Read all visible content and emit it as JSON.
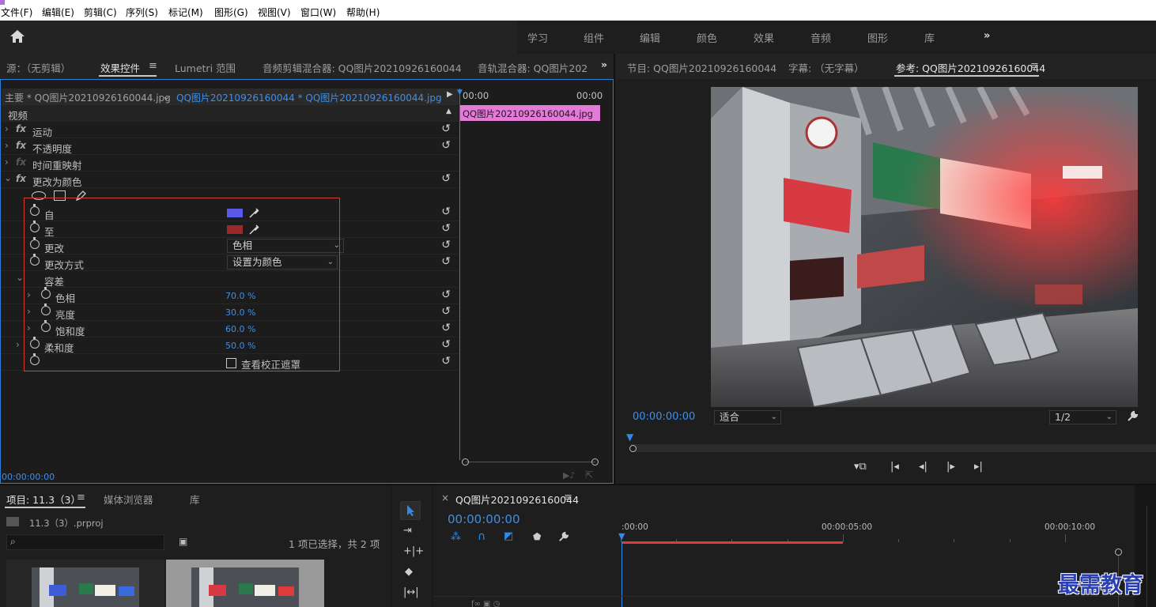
{
  "menu": [
    "文件(F)",
    "编辑(E)",
    "剪辑(C)",
    "序列(S)",
    "标记(M)",
    "图形(G)",
    "视图(V)",
    "窗口(W)",
    "帮助(H)"
  ],
  "workspaces": [
    "学习",
    "组件",
    "编辑",
    "颜色",
    "效果",
    "音频",
    "图形",
    "库"
  ],
  "effects_panel": {
    "tabs": [
      "源：（无剪辑）",
      "效果控件",
      "Lumetri 范围",
      "音频剪辑混合器: QQ图片20210926160044",
      "音轨混合器: QQ图片202"
    ],
    "clip_master": "主要 * QQ图片20210926160044.jpg",
    "clip_seq": "QQ图片20210926160044 * QQ图片20210926160044.jpg",
    "tl_start": "00:00",
    "tl_end": "00:00",
    "clip_bar": "QQ图片20210926160044.jpg",
    "section_video": "视频",
    "fx_motion": "运动",
    "fx_opacity": "不透明度",
    "fx_timeremap": "时间重映射",
    "fx_changecolor": "更改为颜色",
    "from_label": "自",
    "to_label": "至",
    "change_label": "更改",
    "change_value": "色相",
    "method_label": "更改方式",
    "method_value": "设置为颜色",
    "tolerance_label": "容差",
    "hue_label": "色相",
    "hue_value": "70.0 %",
    "lightness_label": "亮度",
    "lightness_value": "30.0 %",
    "saturation_label": "饱和度",
    "saturation_value": "60.0 %",
    "softness_label": "柔和度",
    "softness_value": "50.0 %",
    "mask_label": "查看校正遮罩",
    "timecode": "00:00:00:00",
    "from_color": "#5a5ae6",
    "to_color": "#9a2a2a"
  },
  "program_panel": {
    "tabs": [
      "节目: QQ图片20210926160044",
      "字幕: （无字幕）",
      "参考: QQ图片20210926160044"
    ],
    "timecode": "00:00:00:00",
    "fit": "适合",
    "resolution": "1/2"
  },
  "project_panel": {
    "tabs": [
      "项目: 11.3（3）",
      "媒体浏览器",
      "库"
    ],
    "file": "11.3（3）.prproj",
    "status": "1 项已选择，共 2 项"
  },
  "timeline_panel": {
    "sequence": "QQ图片20210926160044",
    "timecode": "00:00:00:00",
    "ruler": [
      ":00:00",
      "00:00:05:00",
      "00:00:10:00"
    ]
  },
  "watermark": "最需教育",
  "accent": "#2d8ceb"
}
